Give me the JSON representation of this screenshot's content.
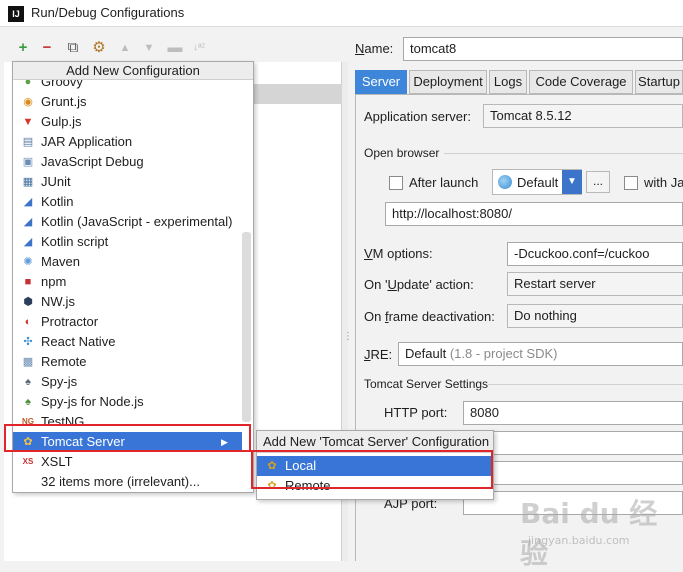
{
  "window": {
    "title": "Run/Debug Configurations",
    "app_icon": "IJ"
  },
  "toolbar": {
    "add_icon": "+",
    "remove_icon": "−",
    "copy_icon": "⧉",
    "wrench_icon": "⚙",
    "up_icon": "▲",
    "down_icon": "▼",
    "folder_icon": "▬",
    "sort_icon": "↓ᵃᶻ"
  },
  "popup": {
    "title": "Add New Configuration",
    "items": [
      {
        "label": "Groovy",
        "icon": "●",
        "color": "#5a9e4a"
      },
      {
        "label": "Grunt.js",
        "icon": "◉",
        "color": "#d88c1f"
      },
      {
        "label": "Gulp.js",
        "icon": "▼",
        "color": "#d9352b"
      },
      {
        "label": "JAR Application",
        "icon": "▤",
        "color": "#5b7ea8"
      },
      {
        "label": "JavaScript Debug",
        "icon": "▣",
        "color": "#6a8db3"
      },
      {
        "label": "JUnit",
        "icon": "▦",
        "color": "#3c6c9c"
      },
      {
        "label": "Kotlin",
        "icon": "◢",
        "color": "#3b74c8"
      },
      {
        "label": "Kotlin (JavaScript - experimental)",
        "icon": "◢",
        "color": "#3b74c8"
      },
      {
        "label": "Kotlin script",
        "icon": "◢",
        "color": "#3b74c8"
      },
      {
        "label": "Maven",
        "icon": "✺",
        "color": "#5f9ed8"
      },
      {
        "label": "npm",
        "icon": "■",
        "color": "#c63030"
      },
      {
        "label": "NW.js",
        "icon": "⬢",
        "color": "#2b3f5c"
      },
      {
        "label": "Protractor",
        "icon": "◐",
        "color": "#d13a3a"
      },
      {
        "label": "React Native",
        "icon": "✣",
        "color": "#3a8ed8"
      },
      {
        "label": "Remote",
        "icon": "▩",
        "color": "#6a8db3"
      },
      {
        "label": "Spy-js",
        "icon": "♠",
        "color": "#5b6b7b"
      },
      {
        "label": "Spy-js for Node.js",
        "icon": "♠",
        "color": "#4d8f3a"
      },
      {
        "label": "TestNG",
        "icon": "NG",
        "color": "#c05a2a"
      },
      {
        "label": "Tomcat Server",
        "icon": "✿",
        "color": "#d8a21f",
        "selected": true,
        "has_submenu": true
      },
      {
        "label": "XSLT",
        "icon": "XS",
        "color": "#c63030"
      },
      {
        "label": "32 items more (irrelevant)...",
        "icon": "",
        "color": "#000000"
      }
    ],
    "submenu_arrow": "▶"
  },
  "submenu": {
    "title": "Add New 'Tomcat Server' Configuration",
    "items": [
      {
        "label": "Local",
        "icon": "✿",
        "selected": true
      },
      {
        "label": "Remote",
        "icon": "✿",
        "selected": false
      }
    ]
  },
  "config": {
    "name_label": "Name:",
    "name_value": "tomcat8",
    "tabs": [
      "Server",
      "Deployment",
      "Logs",
      "Code Coverage",
      "Startup"
    ],
    "app_server_label": "Application server:",
    "app_server_value": "Tomcat 8.5.12",
    "open_browser_label": "Open browser",
    "after_launch_label": "After launch",
    "browser_value": "Default",
    "browser_more": "...",
    "with_js_label": "with Ja",
    "url_value": "http://localhost:8080/",
    "vm_options_label": "VM options:",
    "vm_options_value": "-Dcuckoo.conf=/cuckoo",
    "on_update_label": "On 'Update' action:",
    "on_update_value": "Restart server",
    "on_frame_label": "On frame deactivation:",
    "on_frame_value": "Do nothing",
    "jre_label": "JRE:",
    "jre_value": "Default",
    "jre_hint": "(1.8 - project SDK)",
    "tomcat_settings_label": "Tomcat Server Settings",
    "http_port_label": "HTTP port:",
    "http_port_value": "8080",
    "ajp_port_label": "AJP port:"
  },
  "watermark": {
    "main": "Bai du 经验",
    "sub": "jingyan.baidu.com"
  }
}
